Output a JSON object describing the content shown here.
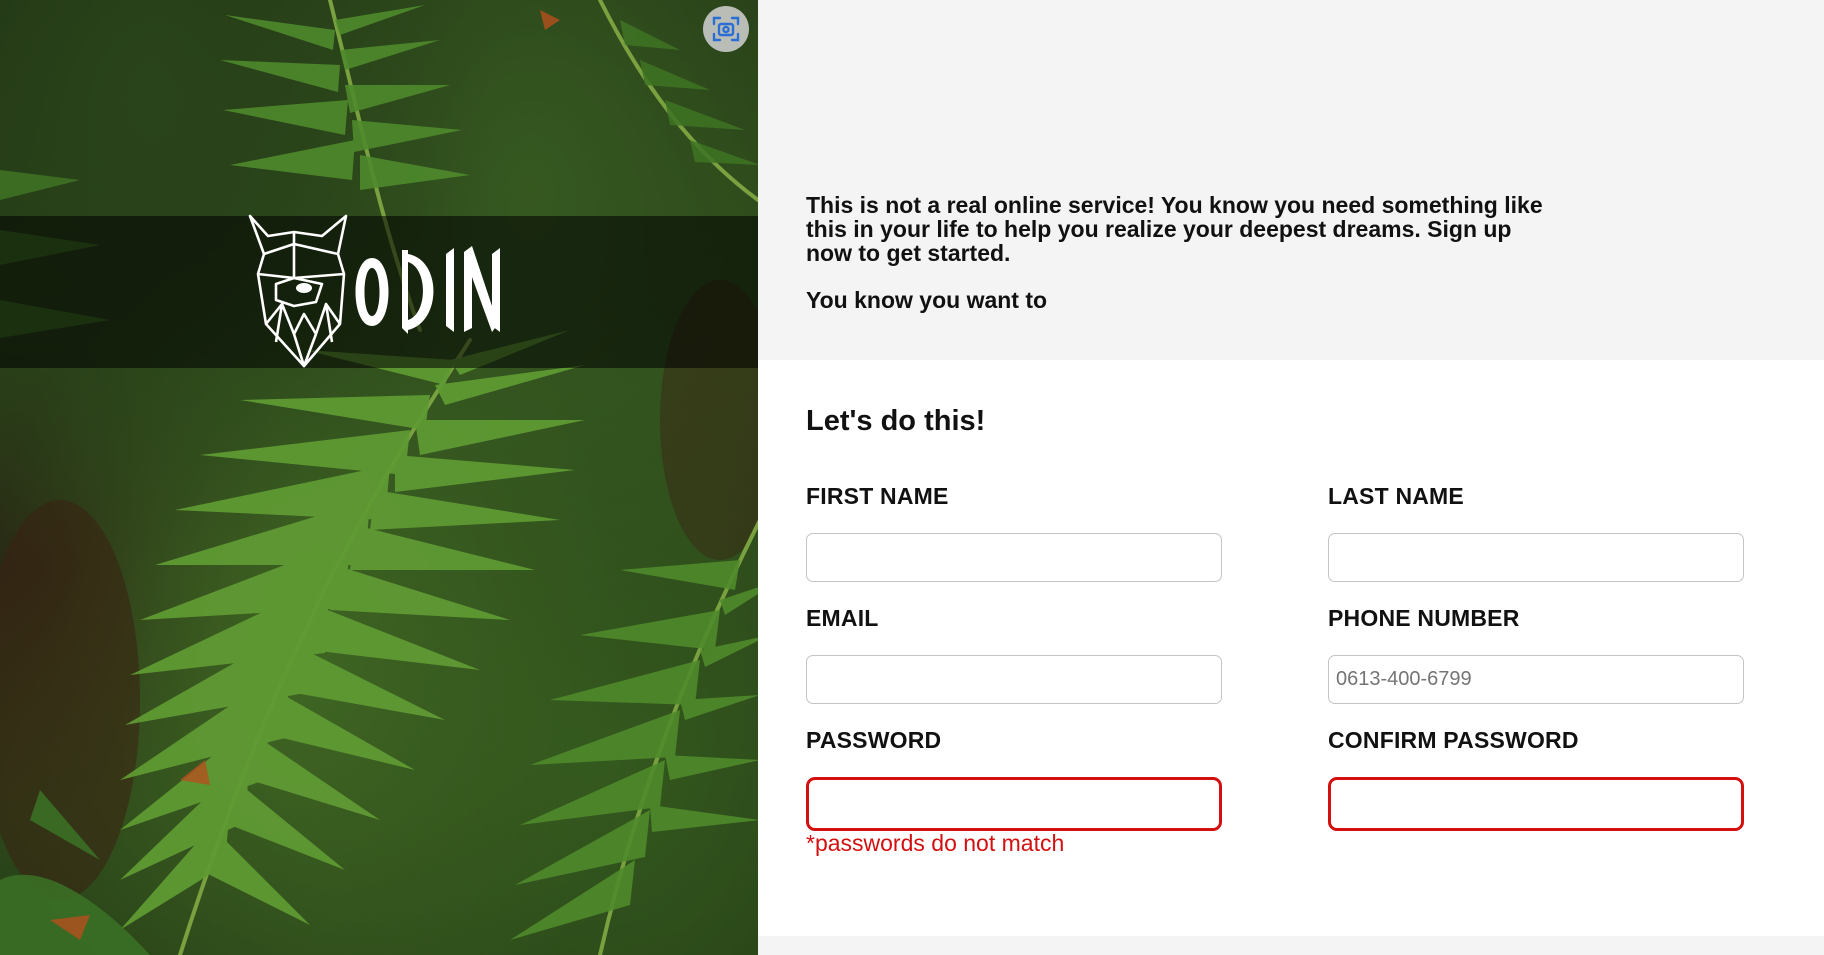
{
  "brand": {
    "name": "ODIN"
  },
  "intro": {
    "paragraph1": "This is not a real online service! You know you need something like this in your life to help you realize your deepest dreams. Sign up now to get started.",
    "paragraph2": "You know you want to"
  },
  "form": {
    "title": "Let's do this!",
    "fields": {
      "first_name": {
        "label": "FIRST NAME",
        "value": "",
        "placeholder": ""
      },
      "last_name": {
        "label": "LAST NAME",
        "value": "",
        "placeholder": ""
      },
      "email": {
        "label": "EMAIL",
        "value": "",
        "placeholder": ""
      },
      "phone": {
        "label": "PHONE NUMBER",
        "value": "",
        "placeholder": "0613-400-6799"
      },
      "password": {
        "label": "PASSWORD",
        "value": "",
        "placeholder": ""
      },
      "confirm_password": {
        "label": "CONFIRM PASSWORD",
        "value": "",
        "placeholder": ""
      }
    },
    "error_message": "*passwords do not match"
  },
  "colors": {
    "error": "#d40f0f",
    "intro_bg": "#f4f4f4",
    "form_bg": "#ffffff",
    "screenshot_icon": "#2b6fd6"
  },
  "icons": {
    "screenshot_button": "screenshot-icon",
    "logo": "viking-helmet-icon"
  }
}
